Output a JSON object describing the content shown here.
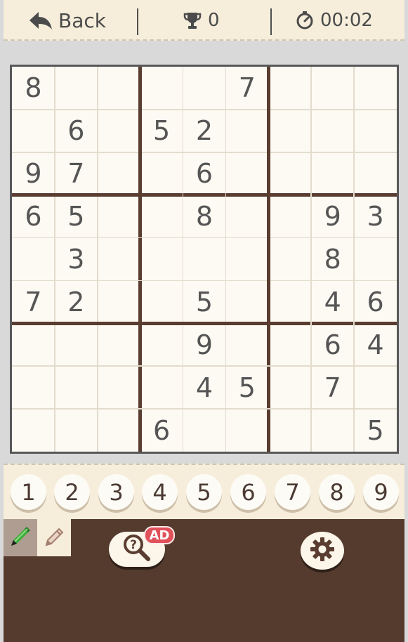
{
  "header": {
    "back_label": "Back",
    "score": "0",
    "timer": "00:02"
  },
  "board": {
    "grid": [
      [
        "8",
        "",
        "",
        "",
        "",
        "7",
        "",
        "",
        ""
      ],
      [
        "",
        "6",
        "",
        "5",
        "2",
        "",
        "",
        "",
        ""
      ],
      [
        "9",
        "7",
        "",
        "",
        "6",
        "",
        "",
        "",
        ""
      ],
      [
        "6",
        "5",
        "",
        "",
        "8",
        "",
        "",
        "9",
        "3"
      ],
      [
        "",
        "3",
        "",
        "",
        "",
        "",
        "",
        "8",
        ""
      ],
      [
        "7",
        "2",
        "",
        "",
        "5",
        "",
        "",
        "4",
        "6"
      ],
      [
        "",
        "",
        "",
        "",
        "9",
        "",
        "",
        "6",
        "4"
      ],
      [
        "",
        "",
        "",
        "",
        "4",
        "5",
        "",
        "7",
        ""
      ],
      [
        "",
        "",
        "",
        "6",
        "",
        "",
        "",
        "",
        "5"
      ]
    ]
  },
  "number_pad": [
    "1",
    "2",
    "3",
    "4",
    "5",
    "6",
    "7",
    "8",
    "9"
  ],
  "toolbar": {
    "ad_badge": "AD",
    "pen_icon": "pen-icon",
    "pencil_icon": "pencil-icon",
    "hint_icon": "hint-magnifier-icon",
    "settings_icon": "gear-icon"
  },
  "colors": {
    "header_bg": "#f6eedb",
    "board_bg": "#fdfaf3",
    "thick_line": "#5a3d30",
    "bottom_bg": "#553b2e",
    "ad_badge": "#e15159",
    "pen_green": "#3fae3a"
  }
}
